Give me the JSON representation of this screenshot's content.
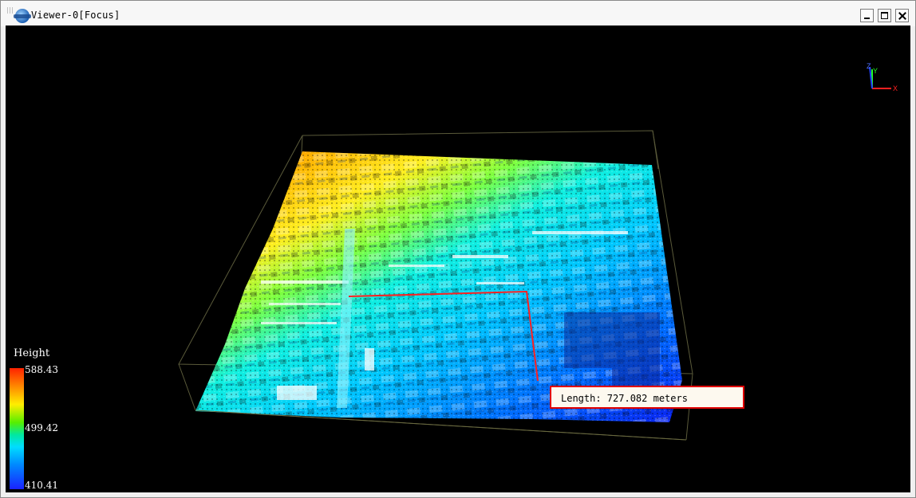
{
  "window": {
    "title": "Viewer-0[Focus]",
    "buttons": {
      "minimize": "minimize",
      "maximize": "maximize",
      "close": "close"
    }
  },
  "viewport": {
    "background": "#000000",
    "axes": {
      "x_label": "X",
      "y_label": "Y",
      "z_label": "Z"
    }
  },
  "legend": {
    "title": "Height",
    "max": "588.43",
    "mid": "499.42",
    "min": "410.41"
  },
  "measurement": {
    "text": "Length: 727.082 meters",
    "line_color": "#ff2020"
  }
}
